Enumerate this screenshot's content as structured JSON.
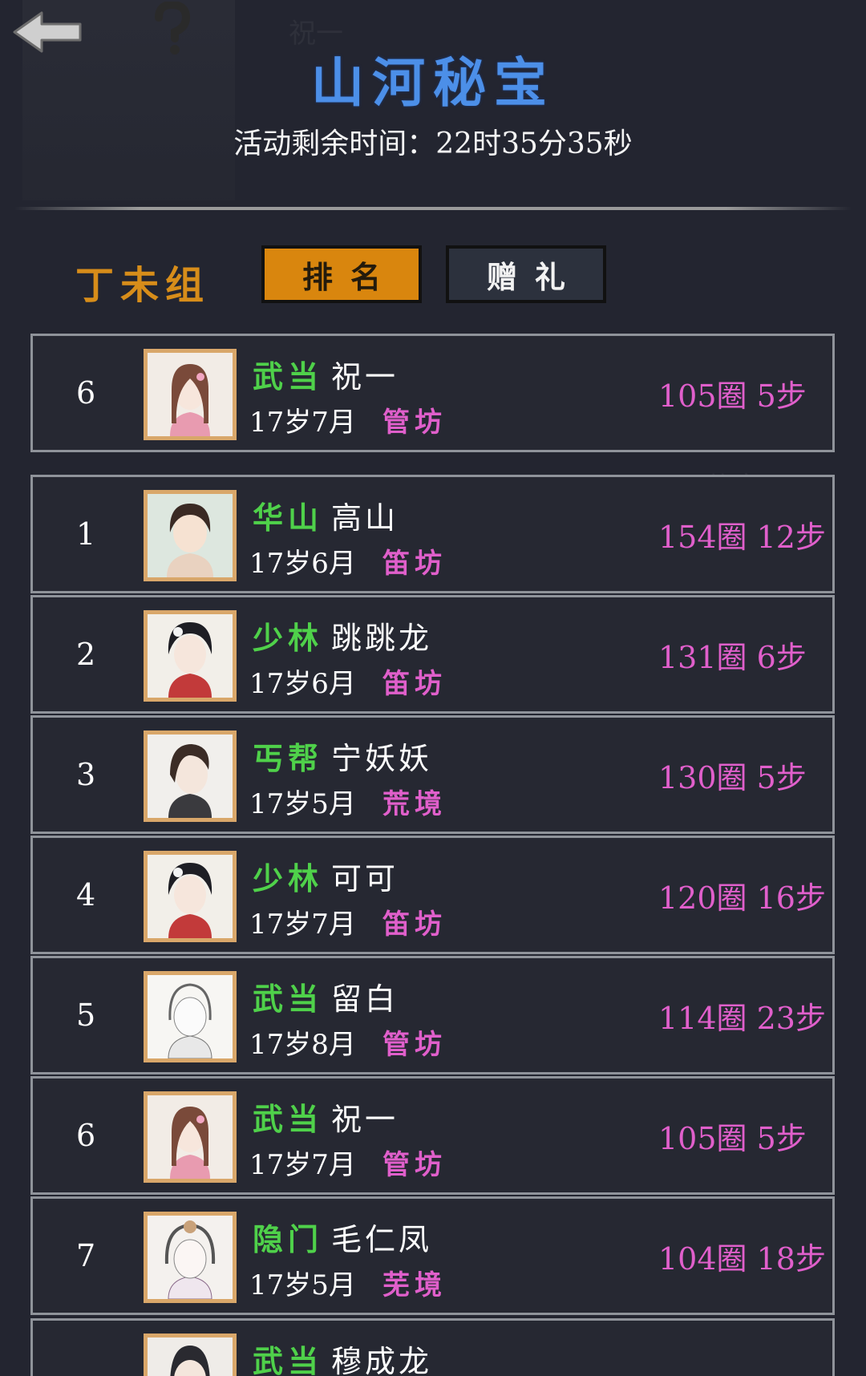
{
  "header": {
    "title": "山河秘宝",
    "timer_label": "活动剩余时间：",
    "timer_value": "22时35分35秒"
  },
  "group": {
    "name": "丁未组",
    "tabs": [
      {
        "label": "排名"
      },
      {
        "label": "赠礼"
      }
    ],
    "selected_tab": "排名"
  },
  "self_entry": {
    "rank": "6",
    "sect": "武当",
    "name": "祝一",
    "age": "17岁7月",
    "realm": "管坊",
    "score": "105圈 5步"
  },
  "ranking": [
    {
      "rank": "1",
      "sect": "华山",
      "name": "高山",
      "age": "17岁6月",
      "realm": "笛坊",
      "score": "154圈 12步"
    },
    {
      "rank": "2",
      "sect": "少林",
      "name": "跳跳龙",
      "age": "17岁6月",
      "realm": "笛坊",
      "score": "131圈 6步"
    },
    {
      "rank": "3",
      "sect": "丐帮",
      "name": "宁妖妖",
      "age": "17岁5月",
      "realm": "荒境",
      "score": "130圈 5步"
    },
    {
      "rank": "4",
      "sect": "少林",
      "name": "可可",
      "age": "17岁7月",
      "realm": "笛坊",
      "score": "120圈 16步"
    },
    {
      "rank": "5",
      "sect": "武当",
      "name": "留白",
      "age": "17岁8月",
      "realm": "管坊",
      "score": "114圈 23步"
    },
    {
      "rank": "6",
      "sect": "武当",
      "name": "祝一",
      "age": "17岁7月",
      "realm": "管坊",
      "score": "105圈 5步"
    },
    {
      "rank": "7",
      "sect": "隐门",
      "name": "毛仁凤",
      "age": "17岁5月",
      "realm": "芜境",
      "score": "104圈 18步"
    },
    {
      "sect": "武当",
      "name": "穆成龙"
    }
  ],
  "colors": {
    "sect": "#4fd14a",
    "realm": "#e05fcb",
    "title": "#4c8fe8",
    "group": "#d78d1a",
    "tab_active": "#d9860e"
  },
  "icons": {
    "back": "arrow-left-icon",
    "help": "question-mark-icon"
  }
}
